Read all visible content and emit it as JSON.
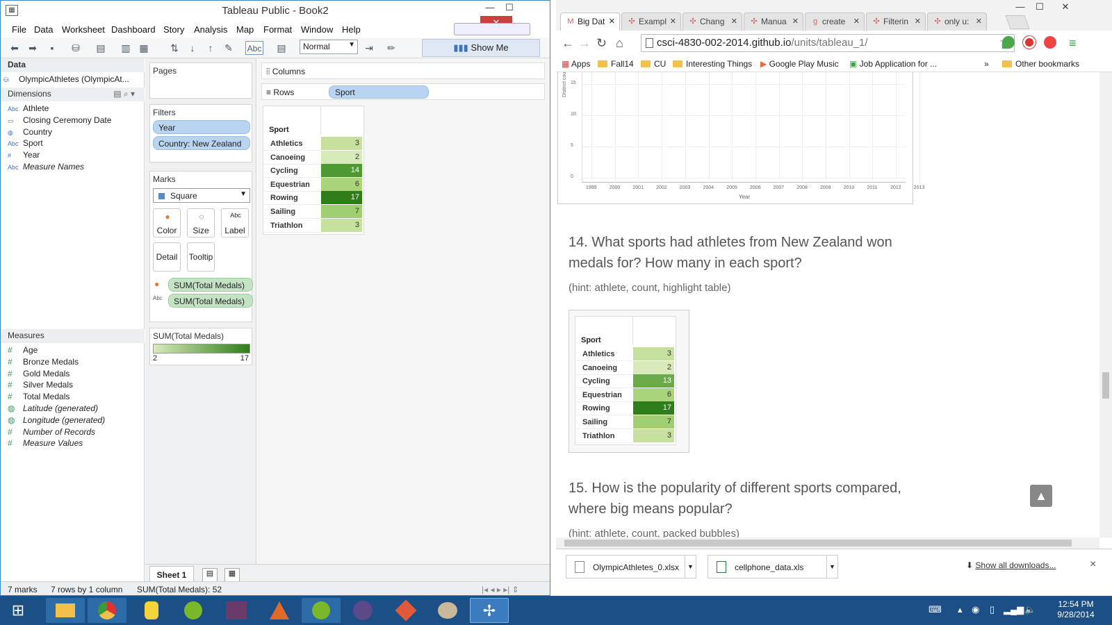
{
  "tableau": {
    "title": "Tableau Public - Book2",
    "menu": [
      "File",
      "Data",
      "Worksheet",
      "Dashboard",
      "Story",
      "Analysis",
      "Map",
      "Format",
      "Window",
      "Help"
    ],
    "toolbar": {
      "fit": "Normal",
      "show_me": "Show Me"
    },
    "data_pane": {
      "header": "Data",
      "datasource": "OlympicAthletes (OlympicAt...",
      "dimensions_label": "Dimensions",
      "dimensions": [
        {
          "type": "Abc",
          "name": "Athlete"
        },
        {
          "type": "date",
          "name": "Closing Ceremony Date"
        },
        {
          "type": "globe",
          "name": "Country"
        },
        {
          "type": "Abc",
          "name": "Sport"
        },
        {
          "type": "#",
          "name": "Year"
        },
        {
          "type": "Abc",
          "name": "Measure Names"
        }
      ],
      "measures_label": "Measures",
      "measures": [
        {
          "type": "#",
          "name": "Age"
        },
        {
          "type": "#",
          "name": "Bronze Medals"
        },
        {
          "type": "#",
          "name": "Gold Medals"
        },
        {
          "type": "#",
          "name": "Silver Medals"
        },
        {
          "type": "#",
          "name": "Total Medals"
        },
        {
          "type": "globe",
          "name": "Latitude (generated)"
        },
        {
          "type": "globe",
          "name": "Longitude (generated)"
        },
        {
          "type": "#",
          "name": "Number of Records"
        },
        {
          "type": "#",
          "name": "Measure Values"
        }
      ]
    },
    "shelves": {
      "pages": "Pages",
      "filters_label": "Filters",
      "filters": [
        "Year",
        "Country: New Zealand"
      ],
      "marks_label": "Marks",
      "mark_type": "Square",
      "mark_buttons": [
        "Color",
        "Size",
        "Label",
        "Detail",
        "Tooltip"
      ],
      "mark_fields": [
        "SUM(Total Medals)",
        "SUM(Total Medals)"
      ],
      "legend_title": "SUM(Total Medals)",
      "legend_min": "2",
      "legend_max": "17",
      "columns": "Columns",
      "rows": "Rows",
      "rows_pill": "Sport"
    },
    "viz": {
      "header": "Sport",
      "rows": [
        {
          "sport": "Athletics",
          "value": "3",
          "color": "#c6e19e"
        },
        {
          "sport": "Canoeing",
          "value": "2",
          "color": "#d8eab9"
        },
        {
          "sport": "Cycling",
          "value": "14",
          "color": "#4d9a32"
        },
        {
          "sport": "Equestrian",
          "value": "6",
          "color": "#a9d47a"
        },
        {
          "sport": "Rowing",
          "value": "17",
          "color": "#2f7d1a"
        },
        {
          "sport": "Sailing",
          "value": "7",
          "color": "#9fcf70"
        },
        {
          "sport": "Triathlon",
          "value": "3",
          "color": "#c6e19e"
        }
      ]
    },
    "sheet_tab": "Sheet 1",
    "status": {
      "marks": "7 marks",
      "dims": "7 rows by 1 column",
      "sum": "SUM(Total Medals): 52"
    }
  },
  "chrome": {
    "tabs": [
      {
        "label": "Big Dat",
        "active": true
      },
      {
        "label": "Exampl",
        "active": false
      },
      {
        "label": "Chang",
        "active": false
      },
      {
        "label": "Manua",
        "active": false
      },
      {
        "label": "create",
        "active": false
      },
      {
        "label": "Filterin",
        "active": false
      },
      {
        "label": "only u:",
        "active": false
      }
    ],
    "url_host": "csci-4830-002-2014.github.io",
    "url_path": "/units/tableau_1/",
    "bookmarks": [
      "Apps",
      "Fall14",
      "CU",
      "Interesting Things",
      "Google Play Music",
      "Job Application for ...",
      "»",
      "Other bookmarks"
    ],
    "page": {
      "chart_ylabel": "Distinct cou",
      "chart_xlabel": "Year",
      "chart_yticks": [
        "15",
        "10",
        "5",
        "0"
      ],
      "chart_xticks": [
        "1999",
        "2000",
        "2001",
        "2002",
        "2003",
        "2004",
        "2005",
        "2006",
        "2007",
        "2008",
        "2009",
        "2010",
        "2011",
        "2012",
        "2013"
      ],
      "q14": "14. What sports had athletes from New Zealand won medals for? How many in each sport?",
      "hint14": "(hint: athlete, count, highlight table)",
      "q15": "15. How is the popularity of different sports compared, where big means popular?",
      "hint15": "(hint: athlete, count, packed bubbles)",
      "image_viz": {
        "header": "Sport",
        "rows": [
          {
            "sport": "Athletics",
            "value": "3",
            "color": "#c6e19e"
          },
          {
            "sport": "Canoeing",
            "value": "2",
            "color": "#d8eab9"
          },
          {
            "sport": "Cycling",
            "value": "13",
            "color": "#6aaa4a"
          },
          {
            "sport": "Equestrian",
            "value": "6",
            "color": "#a9d47a"
          },
          {
            "sport": "Rowing",
            "value": "17",
            "color": "#2f7d1a"
          },
          {
            "sport": "Sailing",
            "value": "7",
            "color": "#9fcf70"
          },
          {
            "sport": "Triathlon",
            "value": "3",
            "color": "#c6e19e"
          }
        ]
      }
    },
    "downloads": [
      "OlympicAthletes_0.xlsx",
      "cellphone_data.xls"
    ],
    "show_all": "Show all downloads...",
    "close": "×"
  },
  "taskbar": {
    "time": "12:54 PM",
    "date": "9/28/2014"
  }
}
